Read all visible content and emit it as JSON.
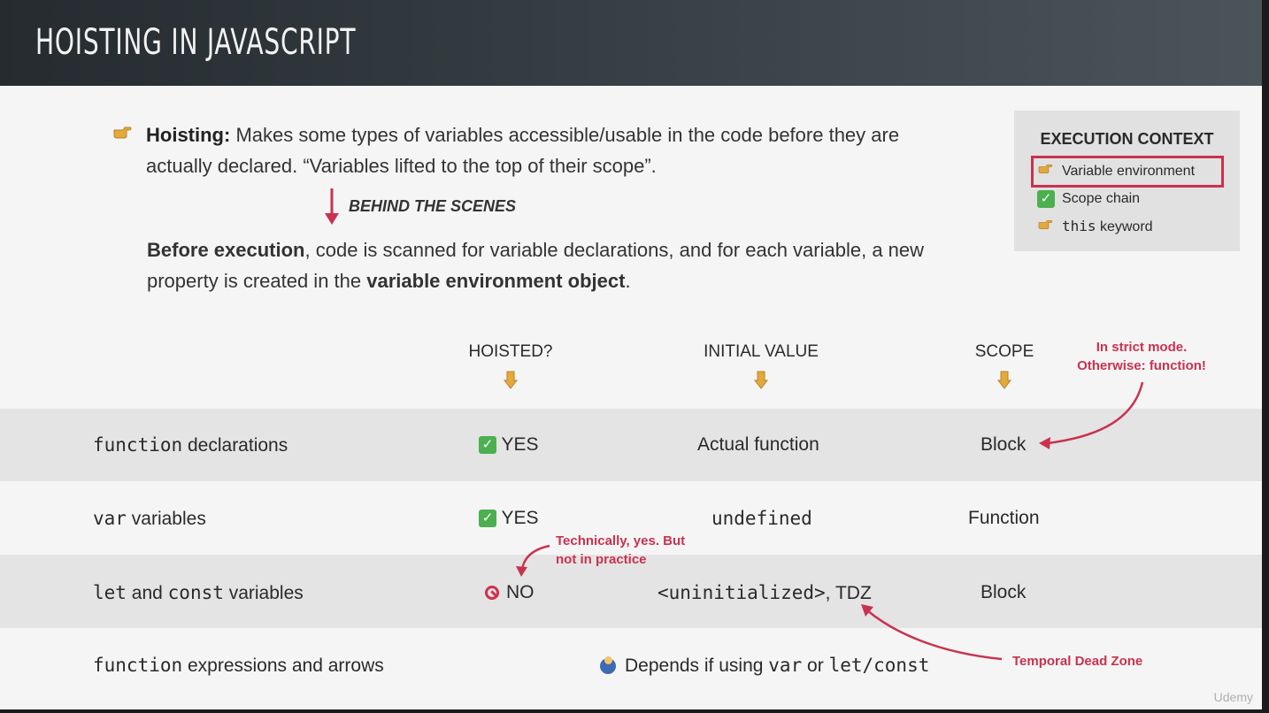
{
  "header": {
    "title": "HOISTING IN JAVASCRIPT"
  },
  "intro": {
    "bullet_icon": "pointing-right-icon",
    "term": "Hoisting:",
    "line1": " Makes some types of variables accessible/usable in the code before they are actually declared. “Variables lifted to the top of their scope”.",
    "behind_label": "BEHIND THE SCENES",
    "before_bold": "Before execution",
    "before_rest": ", code is scanned for variable declarations, and for each variable, a new property is created in the ",
    "before_bold2": "variable environment object",
    "before_end": "."
  },
  "execution_context": {
    "title": "EXECUTION CONTEXT",
    "items": [
      {
        "icon": "pointing-right-icon",
        "label": "Variable environment",
        "highlighted": true
      },
      {
        "icon": "check-icon",
        "label": "Scope chain"
      },
      {
        "icon": "pointing-right-icon",
        "code": "this",
        "label": " keyword"
      }
    ]
  },
  "table": {
    "headers": {
      "hoisted": "HOISTED?",
      "initial": "INITIAL VALUE",
      "scope": "SCOPE"
    },
    "rows": [
      {
        "code": "function",
        "label": " declarations",
        "hoisted": "YES",
        "initial": "Actual function",
        "scope": "Block"
      },
      {
        "code": "var",
        "label": " variables",
        "hoisted": "YES",
        "initial": "undefined",
        "scope": "Function"
      },
      {
        "code": "let",
        "label_mid": " and ",
        "code2": "const",
        "label": " variables",
        "hoisted": "NO",
        "initial": "<uninitialized>",
        "initial_suffix": ", TDZ",
        "scope": "Block"
      },
      {
        "code": "function",
        "label": " expressions and arrows",
        "depends_pre": "Depends if using ",
        "depends_code1": "var",
        "depends_mid": " or ",
        "depends_code2": "let/const"
      }
    ]
  },
  "annotations": {
    "strict": "In strict mode. Otherwise: function!",
    "strict_l1": "In strict mode.",
    "strict_l2": "Otherwise: function!",
    "technically_l1": "Technically, yes. But",
    "technically_l2": "not in practice",
    "tdz": "Temporal Dead Zone"
  },
  "colors": {
    "accent": "#c9324f",
    "header_bg": "#2f363a",
    "check": "#4caf50"
  },
  "watermark": "Udemy"
}
